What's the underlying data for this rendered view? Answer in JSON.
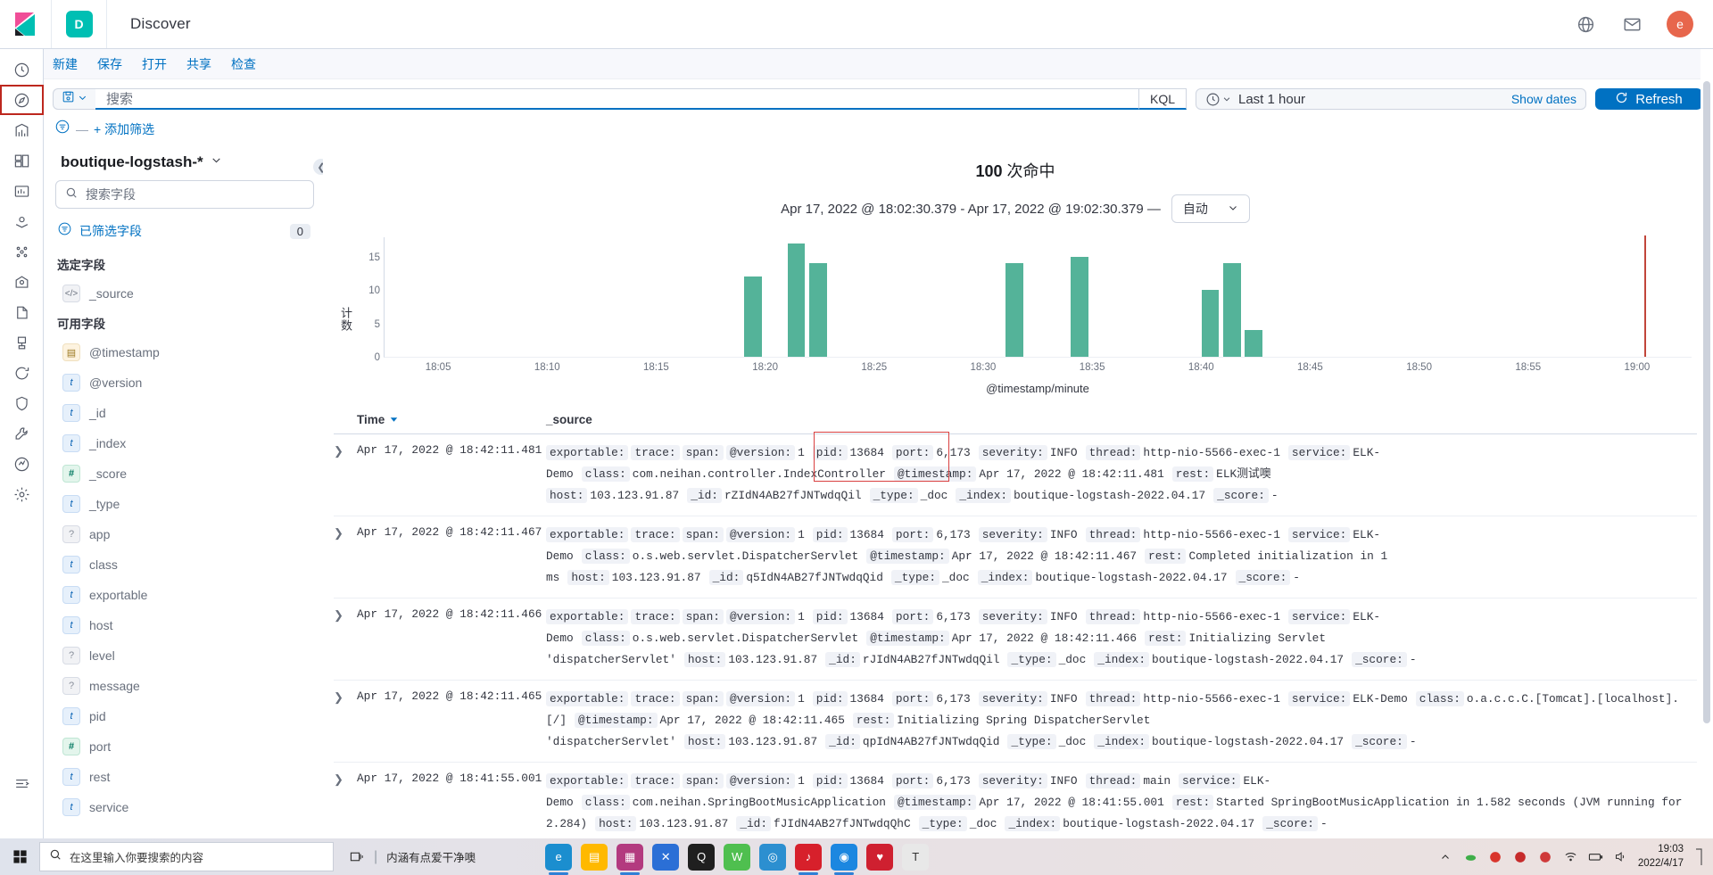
{
  "header": {
    "logo_icon": "kibana-logo",
    "app_badge": "D",
    "app_title": "Discover",
    "icons": [
      "help-icon",
      "mail-icon"
    ],
    "avatar_initial": "e"
  },
  "rail": {
    "items": [
      {
        "name": "recently-viewed",
        "icon": "clock-icon",
        "active": false
      },
      {
        "name": "discover",
        "icon": "compass-icon",
        "active": true
      },
      {
        "name": "visualize",
        "icon": "chart-icon",
        "active": false
      },
      {
        "name": "dashboard",
        "icon": "dashboard-icon",
        "active": false
      },
      {
        "name": "canvas",
        "icon": "canvas-icon",
        "active": false
      },
      {
        "name": "maps",
        "icon": "map-pin-icon",
        "active": false
      },
      {
        "name": "machine-learning",
        "icon": "ml-nodes-icon",
        "active": false
      },
      {
        "name": "infrastructure",
        "icon": "infra-icon",
        "active": false
      },
      {
        "name": "logs",
        "icon": "logs-icon",
        "active": false
      },
      {
        "name": "apm",
        "icon": "apm-icon",
        "active": false
      },
      {
        "name": "uptime",
        "icon": "uptime-icon",
        "active": false
      },
      {
        "name": "siem",
        "icon": "siem-icon",
        "active": false
      },
      {
        "name": "dev-tools",
        "icon": "wrench-icon",
        "active": false
      },
      {
        "name": "monitoring",
        "icon": "monitoring-icon",
        "active": false
      },
      {
        "name": "management",
        "icon": "gear-icon",
        "active": false
      },
      {
        "name": "collapse-nav",
        "icon": "collapse-arrow-icon",
        "active": false
      }
    ]
  },
  "topnav": {
    "items": [
      "新建",
      "保存",
      "打开",
      "共享",
      "检查"
    ]
  },
  "search": {
    "saved_query_icon": "save-disk-icon",
    "placeholder": "搜索",
    "value": "",
    "language": "KQL"
  },
  "timepicker": {
    "clock_icon": "clock-icon",
    "range_label": "Last 1 hour",
    "show_dates": "Show dates",
    "refresh_label": "Refresh",
    "refresh_icon": "refresh-icon",
    "refresh_color": "#0071c2"
  },
  "filters": {
    "filter_icon": "filter-icon",
    "dash": "—",
    "add_label": "+ 添加筛选"
  },
  "sidebar": {
    "index_pattern": "boutique-logstash-*",
    "field_search_placeholder": "搜索字段",
    "filtered_fields_label": "已筛选字段",
    "filtered_fields_count": "0",
    "selected_title": "选定字段",
    "available_title": "可用字段",
    "selected_fields": [
      {
        "name": "_source",
        "type": "src"
      }
    ],
    "available_fields": [
      {
        "name": "@timestamp",
        "type": "date"
      },
      {
        "name": "@version",
        "type": "t"
      },
      {
        "name": "_id",
        "type": "t"
      },
      {
        "name": "_index",
        "type": "t"
      },
      {
        "name": "_score",
        "type": "num"
      },
      {
        "name": "_type",
        "type": "t"
      },
      {
        "name": "app",
        "type": "unk"
      },
      {
        "name": "class",
        "type": "t"
      },
      {
        "name": "exportable",
        "type": "t"
      },
      {
        "name": "host",
        "type": "t"
      },
      {
        "name": "level",
        "type": "unk"
      },
      {
        "name": "message",
        "type": "unk"
      },
      {
        "name": "pid",
        "type": "t"
      },
      {
        "name": "port",
        "type": "num"
      },
      {
        "name": "rest",
        "type": "t"
      },
      {
        "name": "service",
        "type": "t"
      }
    ]
  },
  "main": {
    "hits_count": "100",
    "hits_unit": "次命中",
    "range_text": "Apr 17, 2022 @ 18:02:30.379 - Apr 17, 2022 @ 19:02:30.379 —",
    "interval_label": "自动"
  },
  "chart_data": {
    "type": "bar",
    "title": "",
    "xlabel": "@timestamp/minute",
    "ylabel": "计数",
    "ylim": [
      0,
      17
    ],
    "yticks": [
      0,
      5,
      10,
      15
    ],
    "xticks": [
      "18:05",
      "18:10",
      "18:15",
      "18:20",
      "18:25",
      "18:30",
      "18:35",
      "18:40",
      "18:45",
      "18:50",
      "18:55",
      "19:00"
    ],
    "grid": false,
    "legend": "none",
    "bar_color": "#54B399",
    "now_marker_color": "#C1453A",
    "categories": [
      "18:19",
      "18:21",
      "18:22",
      "18:31",
      "18:34",
      "18:40",
      "18:41",
      "18:42"
    ],
    "values": [
      12,
      17,
      14,
      14,
      15,
      10,
      14,
      4
    ]
  },
  "table": {
    "columns": [
      "Time",
      "_source"
    ],
    "sort_icon": "sort-desc-icon",
    "expand_icon": "chevron-right-icon",
    "highlight_color": "#D94040",
    "rows": [
      {
        "time": "Apr 17, 2022 @ 18:42:11.481",
        "pairs": [
          {
            "k": "exportable:",
            "v": ""
          },
          {
            "k": "trace:",
            "v": ""
          },
          {
            "k": "span:",
            "v": ""
          },
          {
            "k": "@version:",
            "v": "1"
          },
          {
            "k": "pid:",
            "v": "13684"
          },
          {
            "k": "port:",
            "v": "6,173"
          },
          {
            "k": "severity:",
            "v": "INFO"
          },
          {
            "k": "thread:",
            "v": "http-nio-5566-exec-1"
          },
          {
            "k": "service:",
            "v": "ELK-Demo"
          },
          {
            "k": "class:",
            "v": "com.neihan.controller.IndexController"
          },
          {
            "k": "@timestamp:",
            "v": "Apr 17, 2022 @ 18:42:11.481"
          },
          {
            "k": "rest:",
            "v": "ELK测试噢"
          },
          {
            "k": "host:",
            "v": "103.123.91.87"
          },
          {
            "k": "_id:",
            "v": "rZIdN4AB27fJNTwdqQil"
          },
          {
            "k": "_type:",
            "v": "_doc"
          },
          {
            "k": "_index:",
            "v": "boutique-logstash-2022.04.17"
          },
          {
            "k": "_score:",
            "v": "-"
          }
        ]
      },
      {
        "time": "Apr 17, 2022 @ 18:42:11.467",
        "pairs": [
          {
            "k": "exportable:",
            "v": ""
          },
          {
            "k": "trace:",
            "v": ""
          },
          {
            "k": "span:",
            "v": ""
          },
          {
            "k": "@version:",
            "v": "1"
          },
          {
            "k": "pid:",
            "v": "13684"
          },
          {
            "k": "port:",
            "v": "6,173"
          },
          {
            "k": "severity:",
            "v": "INFO"
          },
          {
            "k": "thread:",
            "v": "http-nio-5566-exec-1"
          },
          {
            "k": "service:",
            "v": "ELK-Demo"
          },
          {
            "k": "class:",
            "v": "o.s.web.servlet.DispatcherServlet"
          },
          {
            "k": "@timestamp:",
            "v": "Apr 17, 2022 @ 18:42:11.467"
          },
          {
            "k": "rest:",
            "v": "Completed initialization in 1 ms"
          },
          {
            "k": "host:",
            "v": "103.123.91.87"
          },
          {
            "k": "_id:",
            "v": "q5IdN4AB27fJNTwdqQid"
          },
          {
            "k": "_type:",
            "v": "_doc"
          },
          {
            "k": "_index:",
            "v": "boutique-logstash-2022.04.17"
          },
          {
            "k": "_score:",
            "v": "-"
          }
        ]
      },
      {
        "time": "Apr 17, 2022 @ 18:42:11.466",
        "pairs": [
          {
            "k": "exportable:",
            "v": ""
          },
          {
            "k": "trace:",
            "v": ""
          },
          {
            "k": "span:",
            "v": ""
          },
          {
            "k": "@version:",
            "v": "1"
          },
          {
            "k": "pid:",
            "v": "13684"
          },
          {
            "k": "port:",
            "v": "6,173"
          },
          {
            "k": "severity:",
            "v": "INFO"
          },
          {
            "k": "thread:",
            "v": "http-nio-5566-exec-1"
          },
          {
            "k": "service:",
            "v": "ELK-Demo"
          },
          {
            "k": "class:",
            "v": "o.s.web.servlet.DispatcherServlet"
          },
          {
            "k": "@timestamp:",
            "v": "Apr 17, 2022 @ 18:42:11.466"
          },
          {
            "k": "rest:",
            "v": "Initializing Servlet 'dispatcherServlet'"
          },
          {
            "k": "host:",
            "v": "103.123.91.87"
          },
          {
            "k": "_id:",
            "v": "rJIdN4AB27fJNTwdqQil"
          },
          {
            "k": "_type:",
            "v": "_doc"
          },
          {
            "k": "_index:",
            "v": "boutique-logstash-2022.04.17"
          },
          {
            "k": "_score:",
            "v": "-"
          }
        ]
      },
      {
        "time": "Apr 17, 2022 @ 18:42:11.465",
        "pairs": [
          {
            "k": "exportable:",
            "v": ""
          },
          {
            "k": "trace:",
            "v": ""
          },
          {
            "k": "span:",
            "v": ""
          },
          {
            "k": "@version:",
            "v": "1"
          },
          {
            "k": "pid:",
            "v": "13684"
          },
          {
            "k": "port:",
            "v": "6,173"
          },
          {
            "k": "severity:",
            "v": "INFO"
          },
          {
            "k": "thread:",
            "v": "http-nio-5566-exec-1"
          },
          {
            "k": "service:",
            "v": "ELK-Demo"
          },
          {
            "k": "class:",
            "v": "o.a.c.c.C.[Tomcat].[localhost].[/]"
          },
          {
            "k": "@timestamp:",
            "v": "Apr 17, 2022 @ 18:42:11.465"
          },
          {
            "k": "rest:",
            "v": "Initializing Spring DispatcherServlet 'dispatcherServlet'"
          },
          {
            "k": "host:",
            "v": "103.123.91.87"
          },
          {
            "k": "_id:",
            "v": "qpIdN4AB27fJNTwdqQid"
          },
          {
            "k": "_type:",
            "v": "_doc"
          },
          {
            "k": "_index:",
            "v": "boutique-logstash-2022.04.17"
          },
          {
            "k": "_score:",
            "v": "-"
          }
        ]
      },
      {
        "time": "Apr 17, 2022 @ 18:41:55.001",
        "pairs": [
          {
            "k": "exportable:",
            "v": ""
          },
          {
            "k": "trace:",
            "v": ""
          },
          {
            "k": "span:",
            "v": ""
          },
          {
            "k": "@version:",
            "v": "1"
          },
          {
            "k": "pid:",
            "v": "13684"
          },
          {
            "k": "port:",
            "v": "6,173"
          },
          {
            "k": "severity:",
            "v": "INFO"
          },
          {
            "k": "thread:",
            "v": "main"
          },
          {
            "k": "service:",
            "v": "ELK-Demo"
          },
          {
            "k": "class:",
            "v": "com.neihan.SpringBootMusicApplication"
          },
          {
            "k": "@timestamp:",
            "v": "Apr 17, 2022 @ 18:41:55.001"
          },
          {
            "k": "rest:",
            "v": "Started SpringBootMusicApplication in 1.582 seconds (JVM running for 2.284)"
          },
          {
            "k": "host:",
            "v": "103.123.91.87"
          },
          {
            "k": "_id:",
            "v": "fJIdN4AB27fJNTwdqQhC"
          },
          {
            "k": "_type:",
            "v": "_doc"
          },
          {
            "k": "_index:",
            "v": "boutique-logstash-2022.04.17"
          },
          {
            "k": "_score:",
            "v": "-"
          }
        ]
      }
    ]
  },
  "taskbar": {
    "start_icon": "windows-start-icon",
    "search_placeholder": "在这里输入你要搜索的内容",
    "taskview_icon": "task-view-icon",
    "news_text": "内涵有点爱干净噢",
    "apps": [
      {
        "name": "edge",
        "glyph": "e",
        "color": "#1b8ecf",
        "active": true
      },
      {
        "name": "file-explorer",
        "glyph": "▤",
        "color": "#ffb900",
        "active": false
      },
      {
        "name": "app-3",
        "glyph": "▦",
        "color": "#b33a7f",
        "active": true
      },
      {
        "name": "app-4",
        "glyph": "✕",
        "color": "#2b6fd6",
        "active": false
      },
      {
        "name": "qq",
        "glyph": "Q",
        "color": "#1f1f1f",
        "active": false
      },
      {
        "name": "wechat",
        "glyph": "W",
        "color": "#4fbf4f",
        "active": false
      },
      {
        "name": "app-7",
        "glyph": "◎",
        "color": "#2c8fd0",
        "active": false
      },
      {
        "name": "netease-music",
        "glyph": "♪",
        "color": "#d7202b",
        "active": true
      },
      {
        "name": "app-9",
        "glyph": "◉",
        "color": "#1c87e0",
        "active": true
      },
      {
        "name": "app-10",
        "glyph": "♥",
        "color": "#cf2030",
        "active": false
      },
      {
        "name": "terminal",
        "glyph": "T",
        "color": "#e8e8e8",
        "active": false
      }
    ],
    "tray_icons": [
      "chevron-up-icon",
      "cloud-icon",
      "shield-icon",
      "app-tray-icon",
      "app-tray-icon-2",
      "network-icon",
      "battery-icon",
      "volume-icon"
    ],
    "clock_time": "19:03",
    "clock_date": "2022/4/17"
  }
}
